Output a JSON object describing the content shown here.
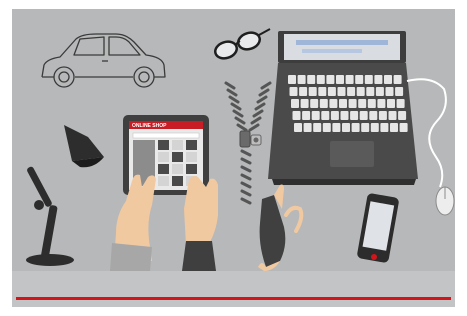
{
  "tablet": {
    "header_label": "ONLINE SHOP"
  },
  "colors": {
    "background": "#b7b8b9",
    "accent_red": "#d3141b",
    "dark_gray": "#3a3a3a",
    "skin": "#f1c9a0"
  },
  "icons": [
    "car-icon",
    "glasses-icon",
    "laptop-icon",
    "desk-lamp-icon",
    "tablet-icon",
    "zipper-icon",
    "cable-icon",
    "smartphone-icon",
    "mouse-icon"
  ]
}
